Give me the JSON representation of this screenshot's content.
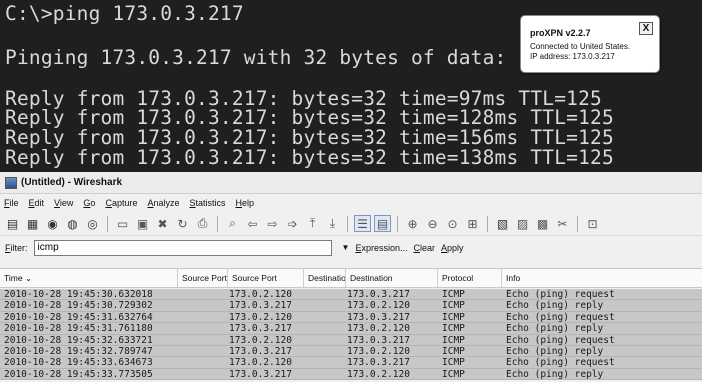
{
  "console": {
    "prompt": "C:\\>ping 173.0.3.217",
    "pinging": "Pinging 173.0.3.217 with 32 bytes of data:",
    "replies": [
      "Reply from 173.0.3.217: bytes=32 time=97ms TTL=125",
      "Reply from 173.0.3.217: bytes=32 time=128ms TTL=125",
      "Reply from 173.0.3.217: bytes=32 time=156ms TTL=125",
      "Reply from 173.0.3.217: bytes=32 time=138ms TTL=125"
    ]
  },
  "vpn_popup": {
    "title": "proXPN v2.2.7",
    "close": "X",
    "message_line1": "Connected to United States.",
    "message_line2": "IP address: 173.0.3.217"
  },
  "wireshark": {
    "window_title": "(Untitled) - Wireshark",
    "menu": [
      "File",
      "Edit",
      "View",
      "Go",
      "Capture",
      "Analyze",
      "Statistics",
      "Help"
    ],
    "filter": {
      "label": "Filter:",
      "value": "icmp",
      "expression": "Expression...",
      "clear": "Clear",
      "apply": "Apply"
    },
    "columns": {
      "time": "Time ⌄",
      "source_port_1": "Source Port",
      "source_port_2": "Source Port",
      "destination_1": "Destination",
      "destination_2": "Destination",
      "protocol": "Protocol",
      "info": "Info"
    },
    "rows": [
      {
        "time": "2010-10-28 19:45:30.632018",
        "src": "173.0.2.120",
        "dst": "173.0.3.217",
        "proto": "ICMP",
        "info": "Echo (ping) request"
      },
      {
        "time": "2010-10-28 19:45:30.729302",
        "src": "173.0.3.217",
        "dst": "173.0.2.120",
        "proto": "ICMP",
        "info": "Echo (ping) reply"
      },
      {
        "time": "2010-10-28 19:45:31.632764",
        "src": "173.0.2.120",
        "dst": "173.0.3.217",
        "proto": "ICMP",
        "info": "Echo (ping) request"
      },
      {
        "time": "2010-10-28 19:45:31.761180",
        "src": "173.0.3.217",
        "dst": "173.0.2.120",
        "proto": "ICMP",
        "info": "Echo (ping) reply"
      },
      {
        "time": "2010-10-28 19:45:32.633721",
        "src": "173.0.2.120",
        "dst": "173.0.3.217",
        "proto": "ICMP",
        "info": "Echo (ping) request"
      },
      {
        "time": "2010-10-28 19:45:32.789747",
        "src": "173.0.3.217",
        "dst": "173.0.2.120",
        "proto": "ICMP",
        "info": "Echo (ping) reply"
      },
      {
        "time": "2010-10-28 19:45:33.634673",
        "src": "173.0.2.120",
        "dst": "173.0.3.217",
        "proto": "ICMP",
        "info": "Echo (ping) request"
      },
      {
        "time": "2010-10-28 19:45:33.773505",
        "src": "173.0.3.217",
        "dst": "173.0.2.120",
        "proto": "ICMP",
        "info": "Echo (ping) reply"
      }
    ]
  },
  "colors": {
    "console_bg": "#1f1f1f",
    "console_text": "#d9d9d9",
    "row_bg": "#c7c7c7"
  }
}
